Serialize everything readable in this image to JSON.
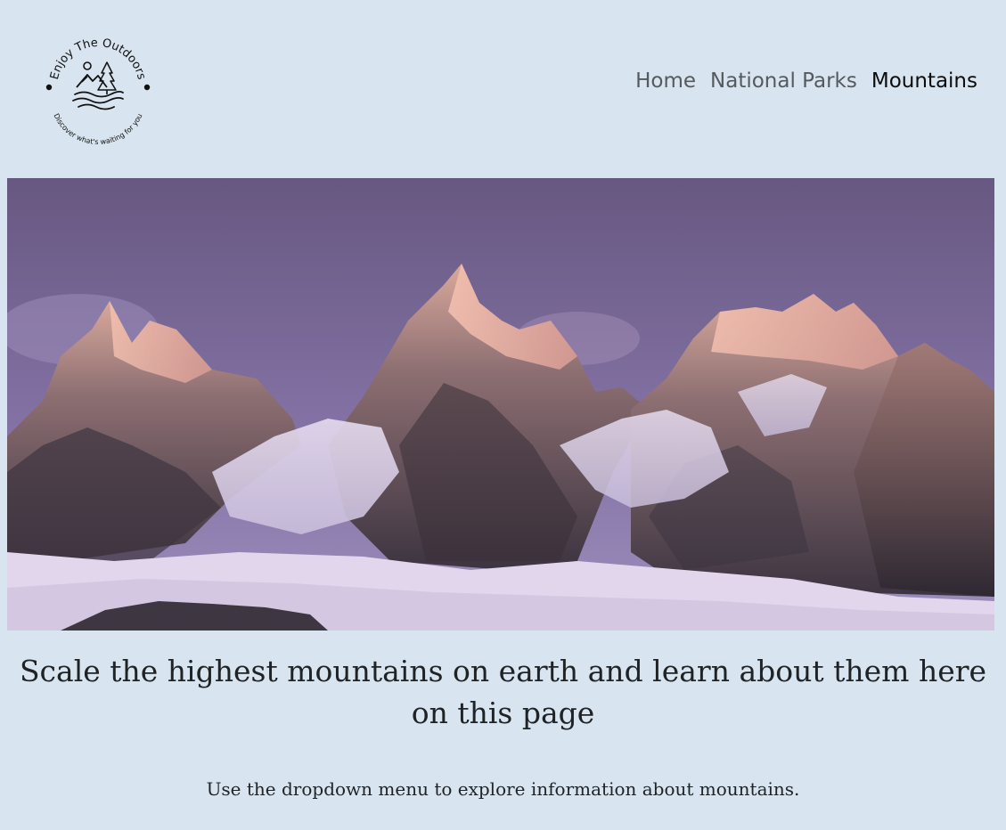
{
  "logo": {
    "title": "Enjoy The Outdoors",
    "tagline": "Discover what's waiting for you",
    "icon": "mountain-tree-waves-icon"
  },
  "nav": {
    "items": [
      {
        "label": "Home",
        "active": false
      },
      {
        "label": "National Parks",
        "active": false
      },
      {
        "label": "Mountains",
        "active": true
      }
    ]
  },
  "hero": {
    "icon": "snowy-mountain-peaks-image"
  },
  "main": {
    "headline": "Scale the highest mountains on earth and learn about them here on this page",
    "instruction": "Use the dropdown menu to explore information about mountains."
  },
  "colors": {
    "background": "#d8e4ef",
    "nav_active": "#0d0d0d",
    "nav_inactive": "#555a5f",
    "sky": "#6e5f8c"
  }
}
